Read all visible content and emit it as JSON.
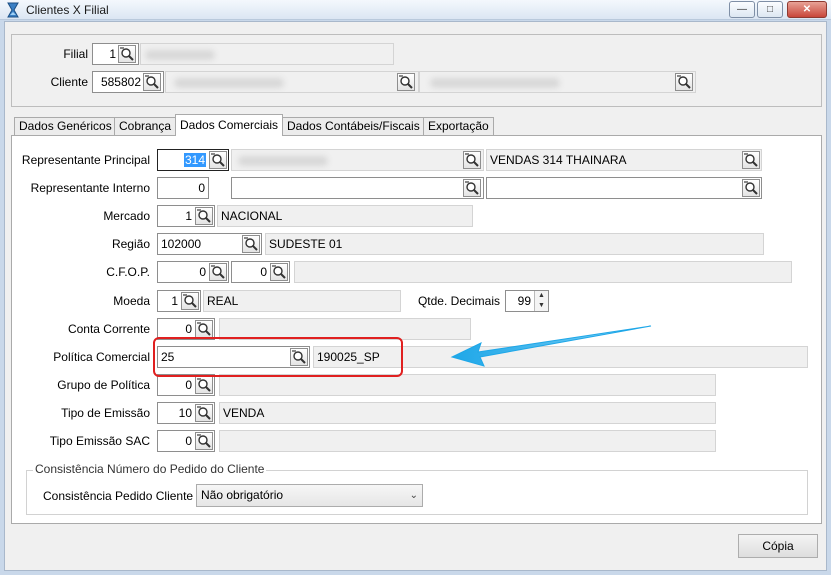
{
  "window": {
    "title": "Clientes X Filial",
    "icon": "hourglass-app-icon",
    "controls": {
      "minimize": "—",
      "maximize": "□",
      "close": "✕"
    }
  },
  "header": {
    "filial": {
      "label": "Filial",
      "code": "1"
    },
    "cliente": {
      "label": "Cliente",
      "code": "585802"
    }
  },
  "tabs": [
    {
      "label": "Dados Genéricos",
      "active": false
    },
    {
      "label": "Cobrança",
      "active": false
    },
    {
      "label": "Dados Comerciais",
      "active": true
    },
    {
      "label": "Dados Contábeis/Fiscais",
      "active": false
    },
    {
      "label": "Exportação",
      "active": false
    }
  ],
  "form": {
    "representante_principal": {
      "label": "Representante Principal",
      "code": "314",
      "name": "VENDAS 314 THAINARA"
    },
    "representante_interno": {
      "label": "Representante Interno",
      "code": "0"
    },
    "mercado": {
      "label": "Mercado",
      "code": "1",
      "desc": "NACIONAL"
    },
    "regiao": {
      "label": "Região",
      "code": "102000",
      "desc": "SUDESTE 01"
    },
    "cfop": {
      "label": "C.F.O.P.",
      "code1": "0",
      "code2": "0"
    },
    "moeda": {
      "label": "Moeda",
      "code": "1",
      "desc": "REAL"
    },
    "qtde_decimais": {
      "label": "Qtde. Decimais",
      "value": "99"
    },
    "conta_corrente": {
      "label": "Conta Corrente",
      "code": "0"
    },
    "politica_comercial": {
      "label": "Política Comercial",
      "code": "25",
      "desc": "190025_SP"
    },
    "grupo_politica": {
      "label": "Grupo de Política",
      "code": "0"
    },
    "tipo_emissao": {
      "label": "Tipo de Emissão",
      "code": "10",
      "desc": "VENDA"
    },
    "tipo_emissao_sac": {
      "label": "Tipo Emissão SAC",
      "code": "0"
    }
  },
  "consistencia": {
    "group_title": "Consistência Número do Pedido do Cliente",
    "label": "Consistência Pedido Cliente",
    "selected": "Não obrigatório"
  },
  "footer": {
    "copia_label": "Cópia"
  },
  "colors": {
    "highlight_box": "#e02020",
    "annotation_arrow": "#1ea7e8",
    "selection": "#3399ff"
  }
}
